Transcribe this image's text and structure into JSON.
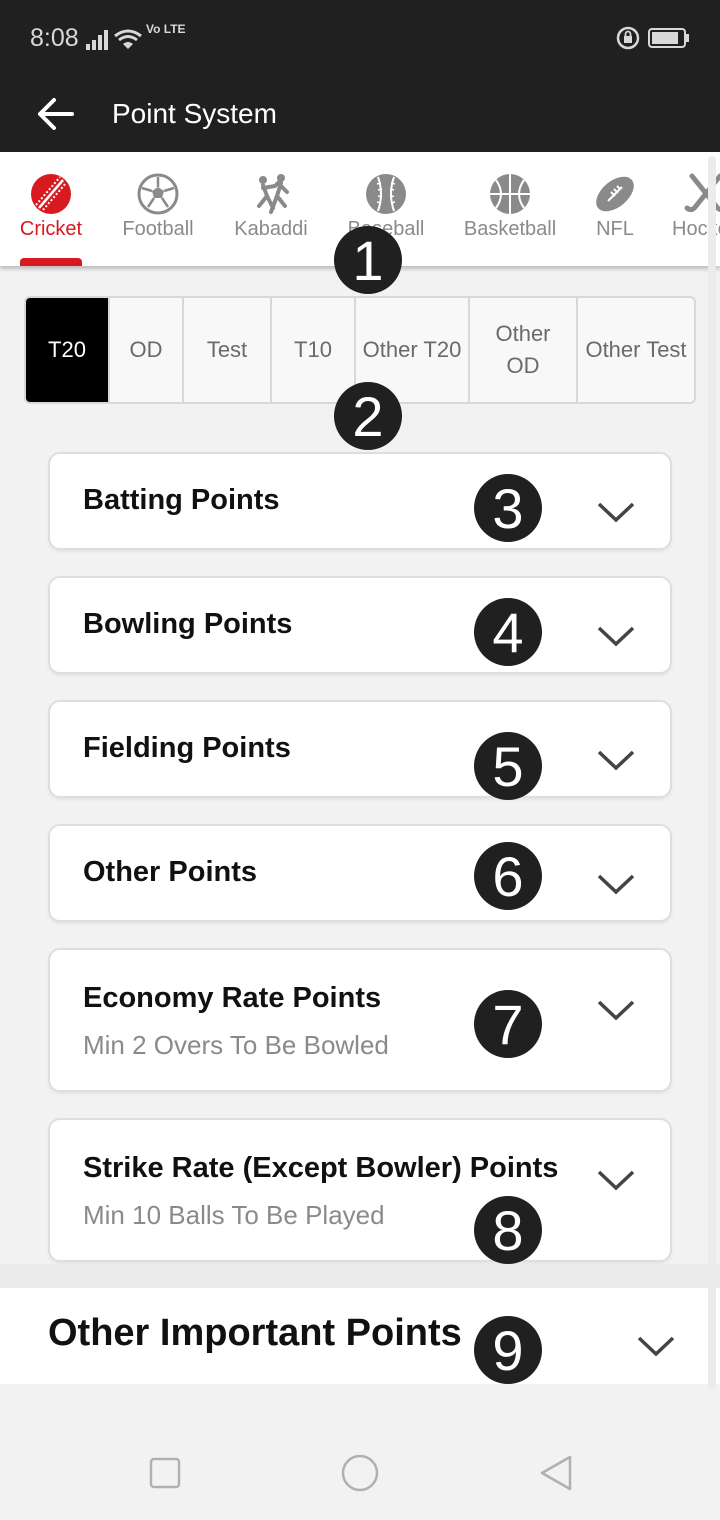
{
  "status_bar": {
    "time": "8:08",
    "network": "Vo LTE"
  },
  "app_bar": {
    "title": "Point System"
  },
  "sports": [
    {
      "label": "Cricket",
      "icon": "cricket-ball-icon",
      "active": true
    },
    {
      "label": "Football",
      "icon": "football-icon"
    },
    {
      "label": "Kabaddi",
      "icon": "kabaddi-icon"
    },
    {
      "label": "Baseball",
      "icon": "baseball-icon"
    },
    {
      "label": "Basketball",
      "icon": "basketball-icon"
    },
    {
      "label": "NFL",
      "icon": "american-football-icon"
    },
    {
      "label": "Hockey",
      "icon": "hockey-icon"
    }
  ],
  "formats": [
    {
      "label": "T20",
      "active": true
    },
    {
      "label": "OD"
    },
    {
      "label": "Test"
    },
    {
      "label": "T10"
    },
    {
      "label": "Other T20"
    },
    {
      "label": "Other OD"
    },
    {
      "label": "Other Test"
    }
  ],
  "sections": [
    {
      "title": "Batting Points"
    },
    {
      "title": "Bowling Points"
    },
    {
      "title": "Fielding Points"
    },
    {
      "title": "Other Points"
    },
    {
      "title": "Economy Rate Points",
      "subtitle": "Min 2 Overs To Be Bowled"
    },
    {
      "title": "Strike Rate (Except Bowler) Points",
      "subtitle": "Min 10 Balls To Be Played"
    }
  ],
  "bottom_section": {
    "title": "Other Important Points"
  },
  "badges": [
    "1",
    "2",
    "3",
    "4",
    "5",
    "6",
    "7",
    "8",
    "9"
  ],
  "colors": {
    "accent": "#d71920",
    "bar": "#202020",
    "active_segment": "#000000"
  }
}
